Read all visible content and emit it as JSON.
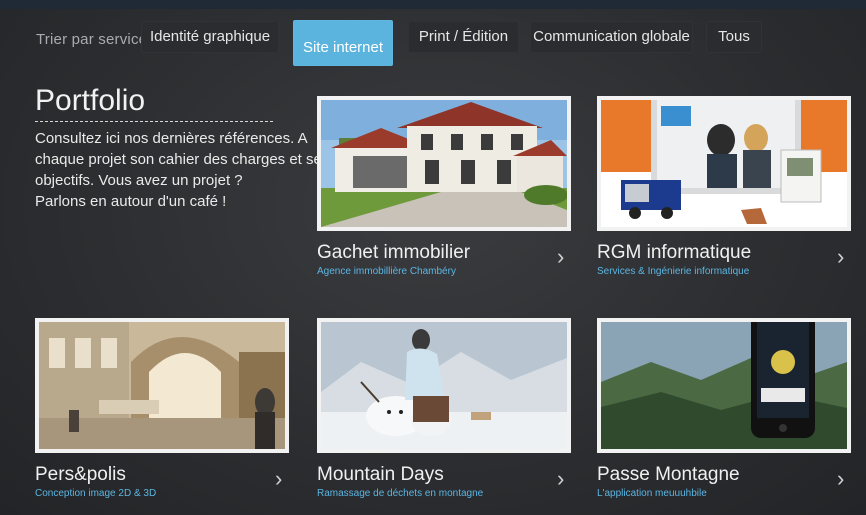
{
  "filter": {
    "label": "Trier par service :",
    "tabs": [
      {
        "label": "Identité graphique"
      },
      {
        "label": "Site internet"
      },
      {
        "label": "Print / Édition"
      },
      {
        "label": "Communication globale"
      },
      {
        "label": "Tous"
      }
    ],
    "active_color": "#5ab4de"
  },
  "intro": {
    "title": "Portfolio",
    "lines": [
      "Consultez ici nos dernières références. A",
      "chaque projet son cahier des charges et ses",
      "objectifs. Vous avez un projet ?",
      "Parlons en autour d'un café !"
    ]
  },
  "projects": [
    {
      "title": "Gachet immobilier",
      "subtitle": "Agence immobillière Chambéry",
      "image": "house-photo"
    },
    {
      "title": "RGM informatique",
      "subtitle": "Services & Ingénierie informatique",
      "image": "sage-software-photo"
    },
    {
      "title": "Pers&polis",
      "subtitle": "Conception image 2D & 3D",
      "image": "interior-3d-render"
    },
    {
      "title": "Mountain Days",
      "subtitle": "Ramassage de déchets en montagne",
      "image": "snowman-photo"
    },
    {
      "title": "Passe Montagne",
      "subtitle": "L'application meuuuhbile",
      "image": "phone-app-photo"
    }
  ],
  "icons": {
    "arrow": "chevron-right-icon"
  }
}
